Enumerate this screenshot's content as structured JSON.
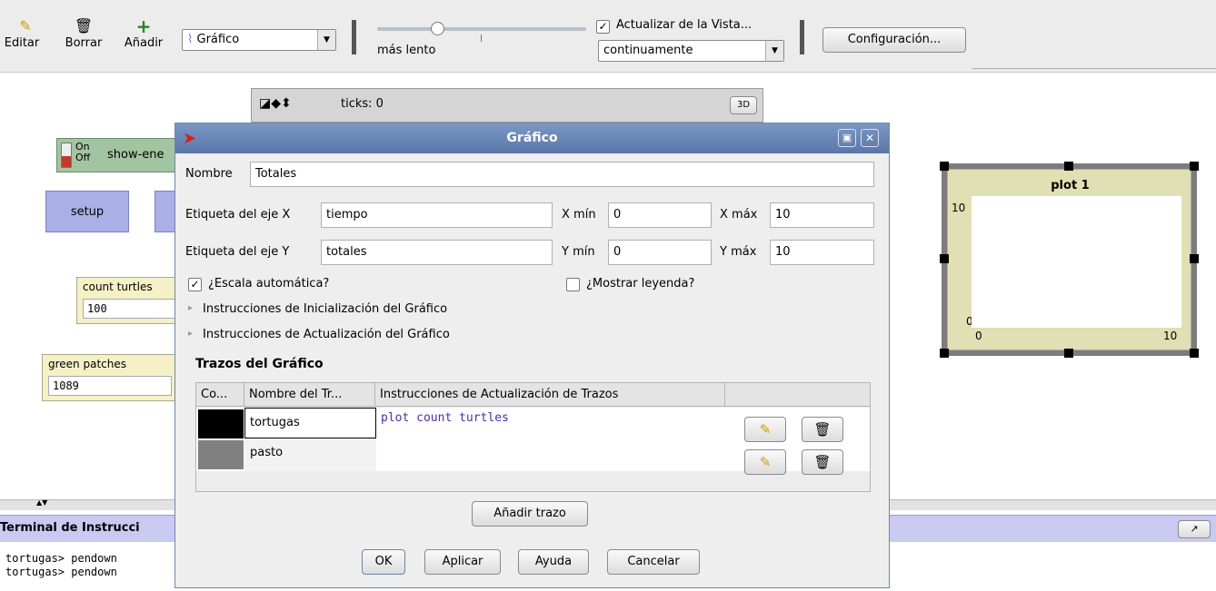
{
  "toolbar": {
    "edit_label": "Editar",
    "delete_label": "Borrar",
    "add_label": "Añadir",
    "widget_combo": "Gráfico",
    "speed_label": "más lento",
    "update_view_label": "Actualizar de la Vista...",
    "update_mode": "continuamente",
    "settings_label": "Configuración..."
  },
  "view": {
    "ticks_label": "ticks: 0",
    "three_d_label": "3D"
  },
  "widgets": {
    "switch_on": "On",
    "switch_off": "Off",
    "switch_label": "show-ene",
    "setup_label": "setup",
    "monitor1_label": "count turtles",
    "monitor1_value": "100",
    "monitor2_label": "green patches",
    "monitor2_value": "1089"
  },
  "plot": {
    "title": "plot 1",
    "ymax": "10",
    "ymin": "0",
    "xmin": "0",
    "xmax": "10"
  },
  "dialog": {
    "title": "Gráfico",
    "name_label": "Nombre",
    "name_value": "Totales",
    "xaxis_label": "Etiqueta del eje X",
    "xaxis_value": "tiempo",
    "xmin_label": "X mín",
    "xmin_value": "0",
    "xmax_label": "X máx",
    "xmax_value": "10",
    "yaxis_label": "Etiqueta del eje Y",
    "yaxis_value": "totales",
    "ymin_label": "Y mín",
    "ymin_value": "0",
    "ymax_label": "Y máx",
    "ymax_value": "10",
    "autoscale_label": "¿Escala automática?",
    "autoscale_checked": true,
    "legend_label": "¿Mostrar leyenda?",
    "legend_checked": false,
    "setup_code_label": "Instrucciones de Inicialización del Gráfico",
    "update_code_label": "Instrucciones de Actualización del Gráfico",
    "pens_section_label": "Trazos del Gráfico",
    "pen_columns": [
      "Co...",
      "Nombre del Tr...",
      "Instrucciones de Actualización de Trazos"
    ],
    "pens": [
      {
        "color": "#000000",
        "name": "tortugas",
        "code": "plot count turtles"
      },
      {
        "color": "#808080",
        "name": "pasto",
        "code": ""
      }
    ],
    "add_pen_label": "Añadir trazo",
    "ok_label": "OK",
    "apply_label": "Aplicar",
    "help_label": "Ayuda",
    "cancel_label": "Cancelar"
  },
  "command_center": {
    "title": "Terminal de Instrucci",
    "lines": [
      "tortugas> pendown",
      "tortugas> pendown"
    ]
  },
  "colors": {
    "dialog_title_bar": "#5a76a8",
    "button_widget": "#aab0e6",
    "monitor_widget": "#f5f0c6",
    "plot_widget": "#e1dfb4",
    "code_text": "#4b2fa6"
  }
}
